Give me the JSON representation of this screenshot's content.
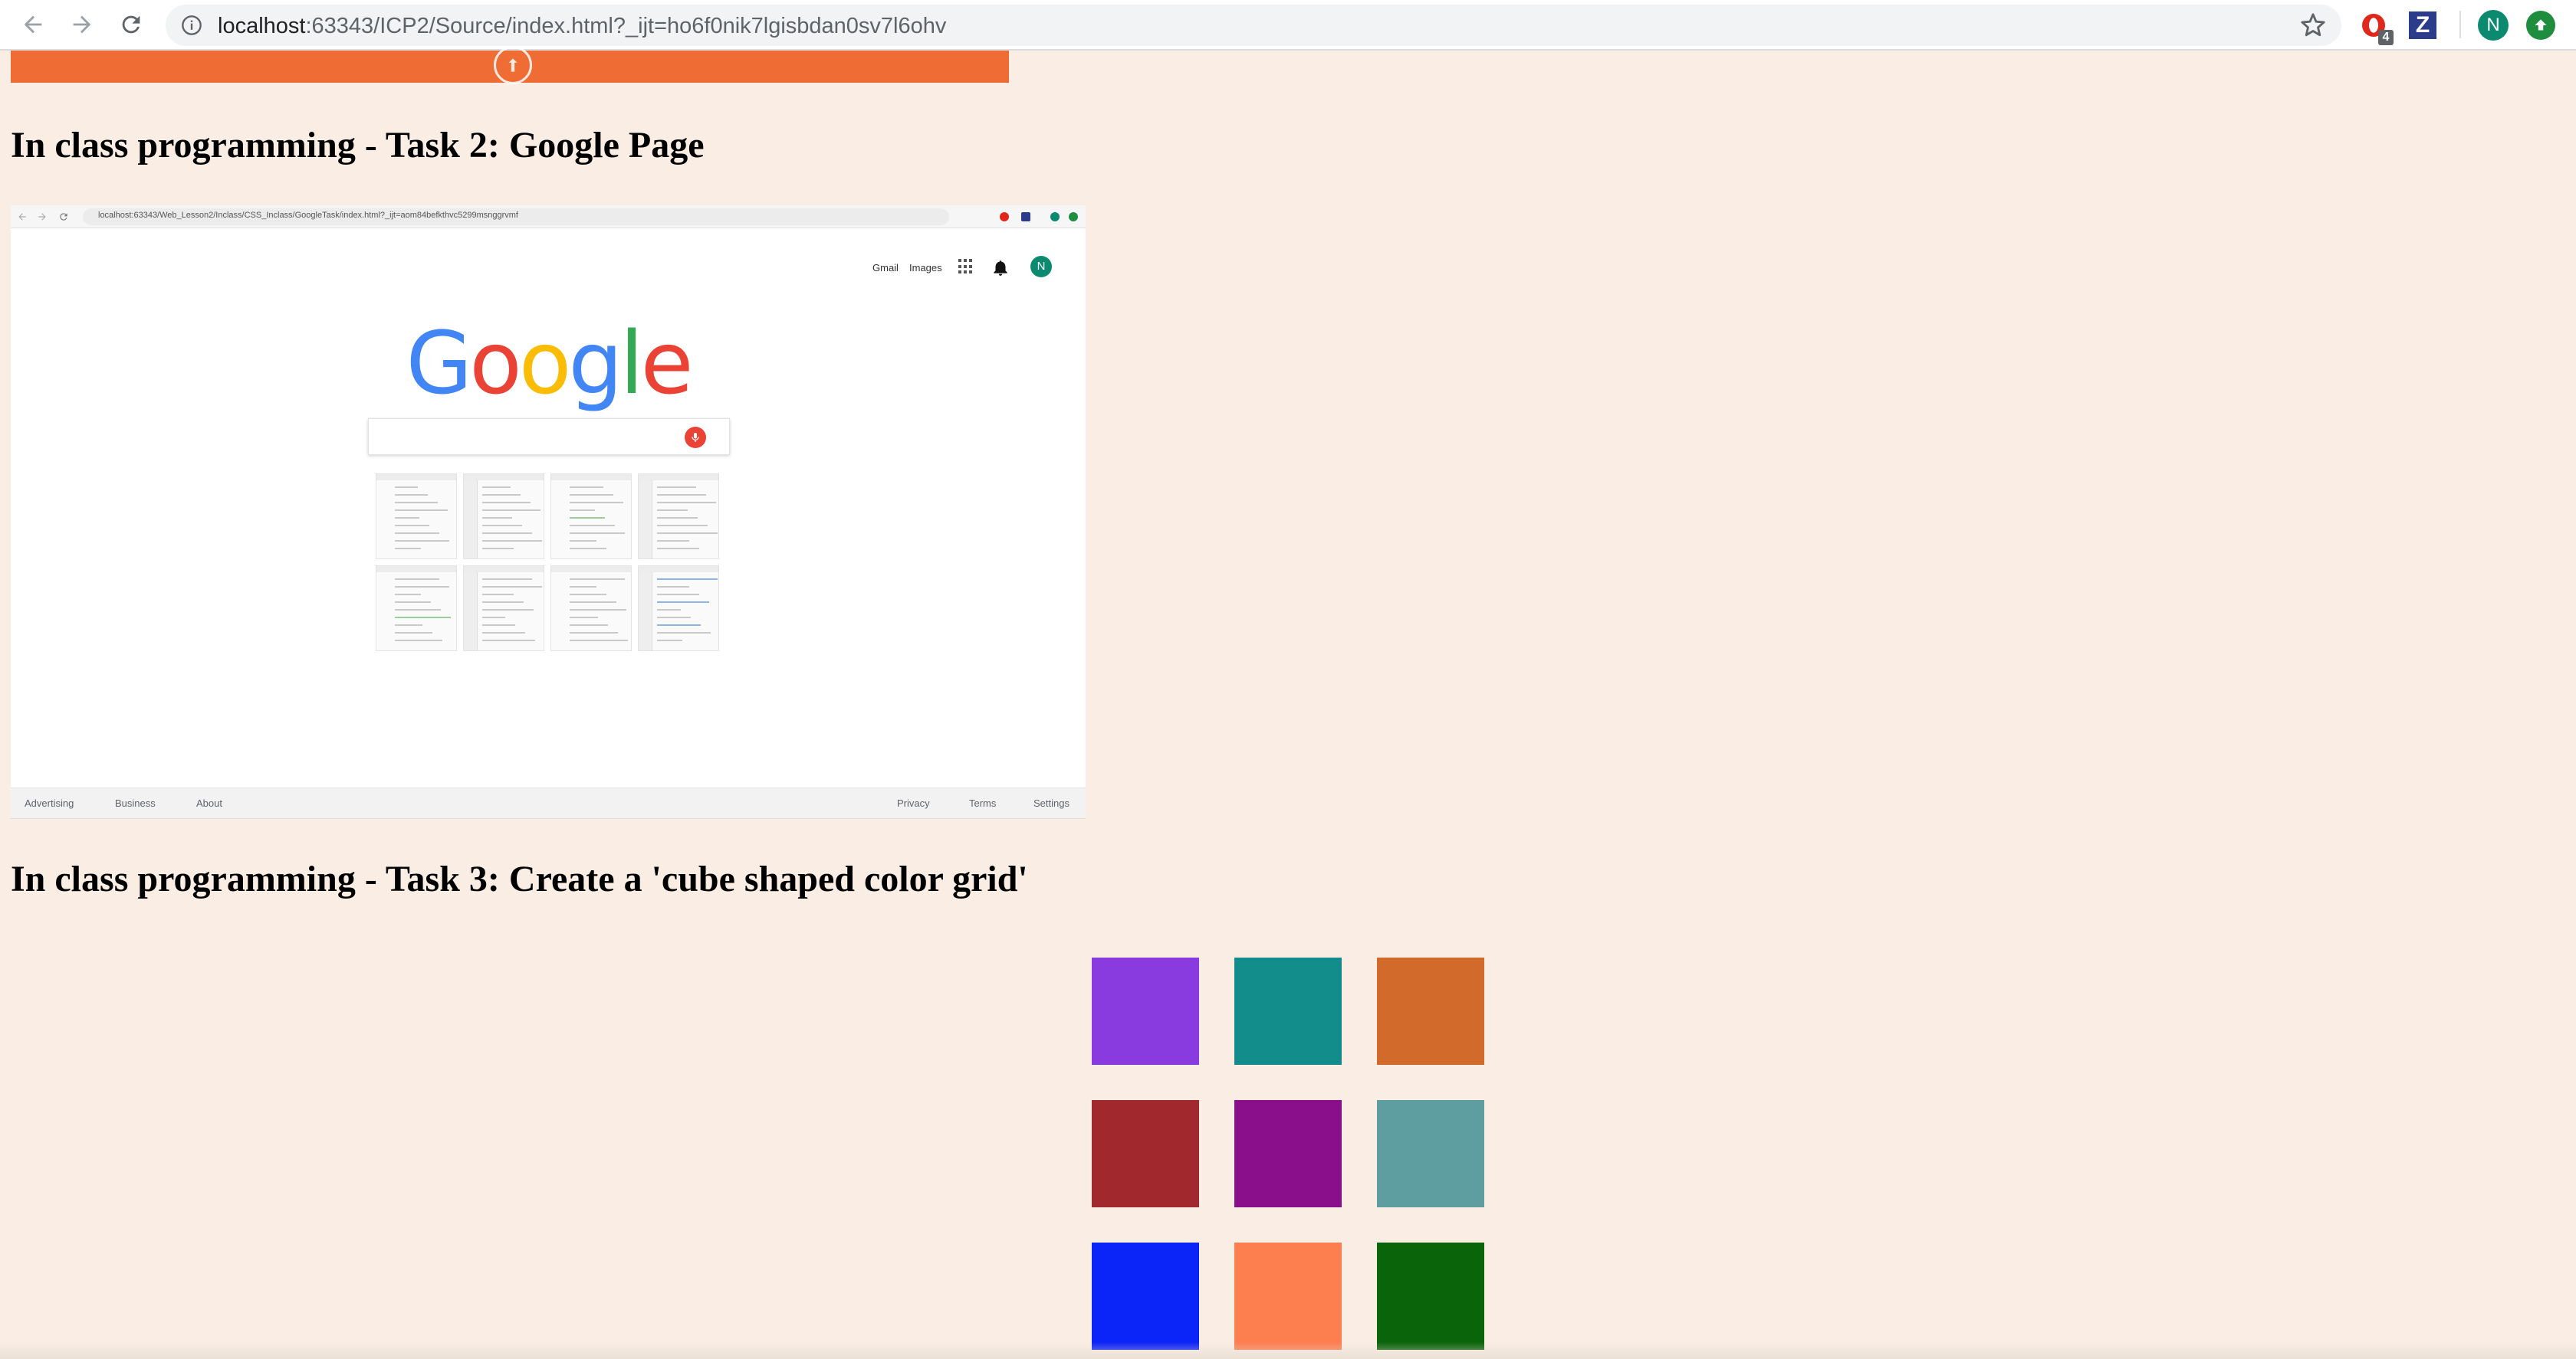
{
  "browser": {
    "url_host": "localhost",
    "url_rest": ":63343/ICP2/Source/index.html?_ijt=ho6f0nik7lgisbdan0sv7l6ohv",
    "extension_badge": "4",
    "z_extension_label": "Z",
    "profile_initial": "N"
  },
  "task2": {
    "heading": "In class programming - Task 2: Google Page",
    "screenshot": {
      "url": "localhost:63343/Web_Lesson2/Inclass/CSS_Inclass/GoogleTask/index.html?_ijt=aom84befkthvc5299msnggrvmf",
      "top_links": [
        "Gmail",
        "Images"
      ],
      "avatar_initial": "N",
      "logo_letters": [
        {
          "ch": "G",
          "color": "#4285f4"
        },
        {
          "ch": "o",
          "color": "#ea4335"
        },
        {
          "ch": "o",
          "color": "#fbbc05"
        },
        {
          "ch": "g",
          "color": "#4285f4"
        },
        {
          "ch": "l",
          "color": "#34a853"
        },
        {
          "ch": "e",
          "color": "#ea4335"
        }
      ],
      "footer_left": [
        "Advertising",
        "Business",
        "About"
      ],
      "footer_right": [
        "Privacy",
        "Terms",
        "Settings"
      ]
    }
  },
  "task3": {
    "heading": "In class programming - Task 3: Create a 'cube shaped color grid'",
    "cubes": [
      {
        "name": "purple-cube",
        "color": "#8a3be0"
      },
      {
        "name": "teal-cube",
        "color": "#138d8b"
      },
      {
        "name": "chocolate-cube",
        "color": "#d26a2c"
      },
      {
        "name": "brown-cube",
        "color": "#a1282d"
      },
      {
        "name": "dark-magenta-cube",
        "color": "#8a0f8b"
      },
      {
        "name": "cadet-blue-cube",
        "color": "#5f9ea0"
      },
      {
        "name": "blue-cube",
        "color": "#0b24f8"
      },
      {
        "name": "coral-cube",
        "color": "#fd7f50"
      },
      {
        "name": "dark-green-cube",
        "color": "#0a640a"
      }
    ]
  },
  "colors": {
    "page_background": "#faeee4",
    "orange_bar": "#f06c35"
  }
}
